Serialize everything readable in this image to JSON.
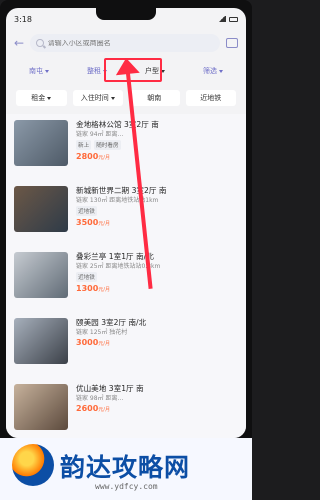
{
  "status": {
    "time": "3:18"
  },
  "search": {
    "placeholder": "请输入小区或商圈名"
  },
  "filters": [
    "南屯",
    "整租",
    "户型",
    "筛选"
  ],
  "chips": [
    "租金",
    "入住时间",
    "朝南",
    "近地铁"
  ],
  "listings": [
    {
      "title": "金地格林公馆 3室2厅 南",
      "sub": "链家 94㎡ 距离…",
      "tags": [
        "新上",
        "随时看房"
      ],
      "price": "2800",
      "unit": "元/月",
      "thumb": "#556a80"
    },
    {
      "title": "新城新世界二期 3室2厅 南",
      "sub": "链家 130㎡ 距离地铁站站1km",
      "tags": [
        "近地铁"
      ],
      "price": "3500",
      "unit": "元/月",
      "thumb": "#394a5d"
    },
    {
      "title": "叠彩兰亭 1室1厅 南/北",
      "sub": "链家 25㎡ 距离地铁站站0.3km",
      "tags": [
        "近地铁"
      ],
      "price": "1300",
      "unit": "元/月",
      "thumb": "#6a7a8b"
    },
    {
      "title": "颐美园 3室2厅 南/北",
      "sub": "链家 125㎡ 独花村",
      "tags": [],
      "price": "3000",
      "unit": "元/月",
      "thumb": "#58606a"
    },
    {
      "title": "优山美地 3室1厅 南",
      "sub": "链家 98㎡ 距离…",
      "tags": [],
      "price": "2600",
      "unit": "元/月",
      "thumb": "#7b6f66"
    }
  ],
  "watermark": {
    "brand": "韵达攻略网",
    "site": "www.ydfcy.com"
  }
}
